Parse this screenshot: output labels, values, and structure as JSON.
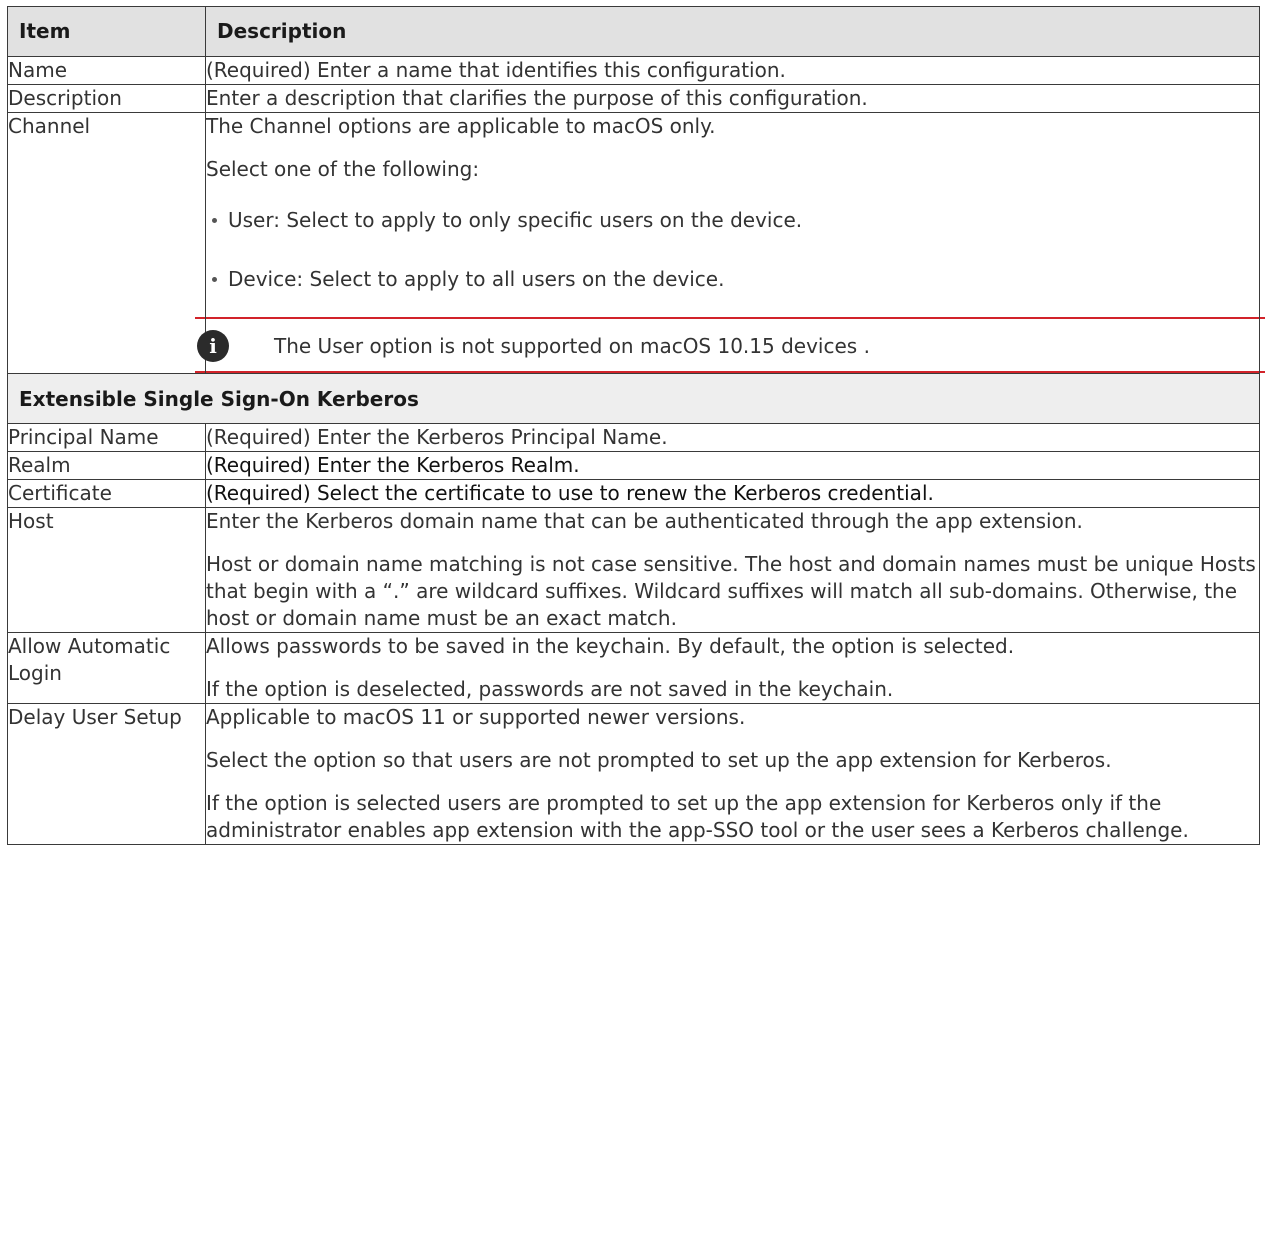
{
  "header": {
    "col_item": "Item",
    "col_description": "Description"
  },
  "rows_top": [
    {
      "item": "Name",
      "desc": [
        "(Required) Enter a name that identifies this configuration."
      ]
    },
    {
      "item": "Description",
      "desc": [
        "Enter a description that clarifies the purpose of this configuration."
      ]
    }
  ],
  "channel": {
    "item": "Channel",
    "intro": "The Channel options are applicable to macOS only.",
    "select": "Select one of the following:",
    "bullets": [
      "User: Select to apply to only specific users on the device.",
      "Device: Select to apply to all users on the device."
    ],
    "note_icon": "info-icon",
    "note": "The User option is not supported on macOS 10.15 devices ."
  },
  "section": {
    "title": "Extensible Single Sign-On Kerberos"
  },
  "rows_bottom": [
    {
      "item": "Principal Name",
      "desc": [
        "(Required) Enter the Kerberos Principal Name."
      ]
    },
    {
      "item": "Realm",
      "desc": [
        "(Required) Enter the Kerberos Realm."
      ]
    },
    {
      "item": "Certificate",
      "desc": [
        "(Required) Select the certificate to use to renew the Kerberos credential."
      ]
    },
    {
      "item": "Host",
      "desc": [
        "Enter the Kerberos domain name that can be authenticated through the app extension.",
        "Host or domain name matching is not case sensitive. The host and domain names must be unique Hosts that begin with a “.” are wildcard suffixes. Wildcard suffixes will match all sub-domains. Otherwise, the host or domain name must be an exact match."
      ]
    },
    {
      "item": "Allow Automatic Login",
      "desc": [
        "Allows passwords to be saved in the keychain. By default, the option is selected.",
        "If the option is deselected, passwords are not saved in the keychain."
      ]
    },
    {
      "item": "Delay User Setup",
      "desc": [
        "Applicable to macOS 11 or supported newer versions.",
        "Select the option so that users are not prompted to set up the app extension for Kerberos.",
        "If the option is selected users are prompted to set up the app extension for Kerberos only if the administrator enables app extension with the app-SSO tool or the user sees a Kerberos challenge."
      ]
    }
  ]
}
